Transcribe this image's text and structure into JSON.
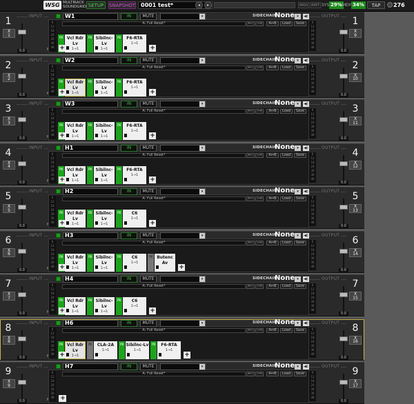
{
  "topbar": {
    "logo": "WSG",
    "logo_sub_1": "MULTIRACK",
    "logo_sub_2": "SOUNDGRID",
    "setup_label": "SETUP",
    "snapshot_label": "SNAPSHOT",
    "snapshot_arrow": "▸",
    "snapshot_name": "0001 test*",
    "nav_prev": "◂",
    "nav_next": "▸",
    "midi_label": "MIDI",
    "rmt_label": "RMT",
    "sys_label": "SYS",
    "sys_value": "29%",
    "mem_label": "MEM",
    "mem_value": "34%",
    "tap_label": "TAP",
    "bpm_value": "276"
  },
  "labels": {
    "input": "INPUT",
    "output": "OUTPUT",
    "in": "IN",
    "mute": "MUTE",
    "sidechain": "SIDECHAIN",
    "preset": "A: Full Reset*",
    "ab_copy": "A→B",
    "load": "Load",
    "save": "Save",
    "add": "+",
    "m": "M",
    "io_value": "0.0",
    "plug_in": "IN",
    "dd_arrow": "▾",
    "speaker": "◀)",
    "undo": "⟵",
    "redo": "⟶",
    "ab_toggle": "A↔B"
  },
  "colors": {
    "accent_green": "#1ca51c",
    "selection_yellow": "#c8b84a",
    "snapshot_magenta": "#d24fd2"
  },
  "rows": [
    {
      "num": "1",
      "name": "W1",
      "x_sel": "X\n1",
      "out_sel": "X\n9",
      "sidechain": "None",
      "selected": false,
      "plugins": [
        {
          "name": "Vcl Rdr Lv",
          "sub": "1→1",
          "in": true,
          "w": 30
        },
        {
          "name": "Sibilnc-Lv",
          "sub": "1→1",
          "in": true,
          "w": 30
        },
        {
          "name": "F6-RTA",
          "sub": "1→1",
          "in": true,
          "w": 34
        }
      ]
    },
    {
      "num": "2",
      "name": "W2",
      "x_sel": "X\n2",
      "out_sel": "X\n10",
      "sidechain": "None",
      "selected": false,
      "plugins": [
        {
          "name": "Vcl Rdr Lv",
          "sub": "1→1",
          "in": true,
          "w": 30,
          "sel": true
        },
        {
          "name": "Sibilnc-Lv",
          "sub": "1→1",
          "in": true,
          "w": 30
        },
        {
          "name": "F6-RTA",
          "sub": "1→1",
          "in": true,
          "w": 34
        }
      ]
    },
    {
      "num": "3",
      "name": "W3",
      "x_sel": "X\n3",
      "out_sel": "X\n11",
      "sidechain": "None",
      "selected": false,
      "plugins": [
        {
          "name": "Vcl Rdr Lv",
          "sub": "1→1",
          "in": true,
          "w": 30
        },
        {
          "name": "Sibilnc-Lv",
          "sub": "1→1",
          "in": true,
          "w": 30
        },
        {
          "name": "F6-RTA",
          "sub": "1→1",
          "in": true,
          "w": 34
        }
      ]
    },
    {
      "num": "4",
      "name": "H1",
      "x_sel": "X\n4",
      "out_sel": "X\n12",
      "sidechain": "None",
      "selected": false,
      "plugins": [
        {
          "name": "Vcl Rdr Lv",
          "sub": "1→1",
          "in": true,
          "w": 30
        },
        {
          "name": "Sibilnc-Lv",
          "sub": "1→1",
          "in": true,
          "w": 30
        },
        {
          "name": "F6-RTA",
          "sub": "1→1",
          "in": true,
          "w": 34
        }
      ]
    },
    {
      "num": "5",
      "name": "H2",
      "x_sel": "X\n5",
      "out_sel": "X\n13",
      "sidechain": "None",
      "selected": false,
      "plugins": [
        {
          "name": "Vcl Rdr Lv",
          "sub": "1→1",
          "in": true,
          "w": 30
        },
        {
          "name": "Sibilnc-Lv",
          "sub": "1→1",
          "in": true,
          "w": 30
        },
        {
          "name": "C6",
          "sub": "1→1",
          "in": true,
          "w": 34
        }
      ]
    },
    {
      "num": "6",
      "name": "H3",
      "x_sel": "X\n6",
      "out_sel": "X\n14",
      "sidechain": "None",
      "selected": false,
      "plugins": [
        {
          "name": "Vcl Rdr Lv",
          "sub": "1→1",
          "in": true,
          "w": 30
        },
        {
          "name": "Sibilnc-Lv",
          "sub": "1→1",
          "in": true,
          "w": 30
        },
        {
          "name": "C6",
          "sub": "1→1",
          "in": true,
          "w": 34
        },
        {
          "name": "Butenc Av",
          "sub": "",
          "in": false,
          "w": 30
        }
      ]
    },
    {
      "num": "7",
      "name": "H4",
      "x_sel": "X\n7",
      "out_sel": "X\n15",
      "sidechain": "None",
      "selected": false,
      "plugins": [
        {
          "name": "Vcl Rdr Lv",
          "sub": "1→1",
          "in": true,
          "w": 30
        },
        {
          "name": "Sibilnc-Lv",
          "sub": "1→1",
          "in": true,
          "w": 30
        },
        {
          "name": "C6",
          "sub": "1→1",
          "in": true,
          "w": 34
        }
      ]
    },
    {
      "num": "8",
      "name": "H6",
      "x_sel": "X\n8",
      "out_sel": "X\n16",
      "sidechain": "None",
      "selected": true,
      "plugins": [
        {
          "name": "Vcl Rdr Lv",
          "sub": "1→1",
          "in": true,
          "w": 30,
          "sel": true
        },
        {
          "name": "CLA-2A",
          "sub": "1→1",
          "in": false,
          "w": 34
        },
        {
          "name": "Sibilnc-Lv",
          "sub": "1→1",
          "in": true,
          "w": 34
        },
        {
          "name": "F6-RTA",
          "sub": "1→1",
          "in": true,
          "w": 34
        }
      ]
    },
    {
      "num": "9",
      "name": "H7",
      "x_sel": "X\n9",
      "out_sel": "X\n17",
      "sidechain": "None",
      "selected": false,
      "plugins": []
    }
  ]
}
